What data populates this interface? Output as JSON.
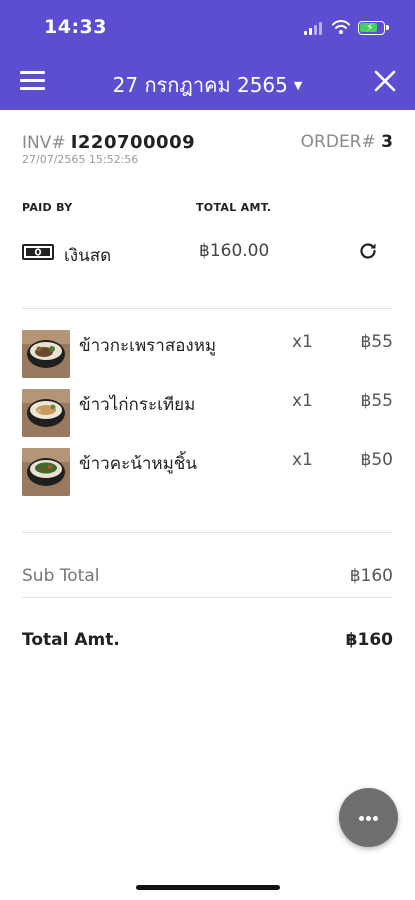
{
  "status_bar": {
    "time": "14:33"
  },
  "header": {
    "date": "27 กรกฎาคม 2565",
    "accent": "#5b4ed1"
  },
  "invoice": {
    "inv_label": "INV#",
    "inv_no": "I220700009",
    "order_label": "ORDER#",
    "order_no": "3",
    "datetime": "27/07/2565 15:52:56"
  },
  "payment": {
    "paid_by_header": "PAID BY",
    "total_amt_header": "TOTAL AMT.",
    "method": "เงินสด",
    "amount": "฿160.00",
    "method_icon": "cash-icon",
    "action_icon": "refresh-icon"
  },
  "items": [
    {
      "name": "ข้าวกะเพราสองหมู",
      "qty": "x1",
      "price": "฿55"
    },
    {
      "name": "ข้าวไก่กระเทียม",
      "qty": "x1",
      "price": "฿55"
    },
    {
      "name": "ข้าวคะน้าหมูชิ้น",
      "qty": "x1",
      "price": "฿50"
    }
  ],
  "summary": {
    "subtotal_label": "Sub Total",
    "subtotal_value": "฿160",
    "total_label": "Total Amt.",
    "total_value": "฿160"
  },
  "fab": {
    "icon": "more-icon"
  }
}
